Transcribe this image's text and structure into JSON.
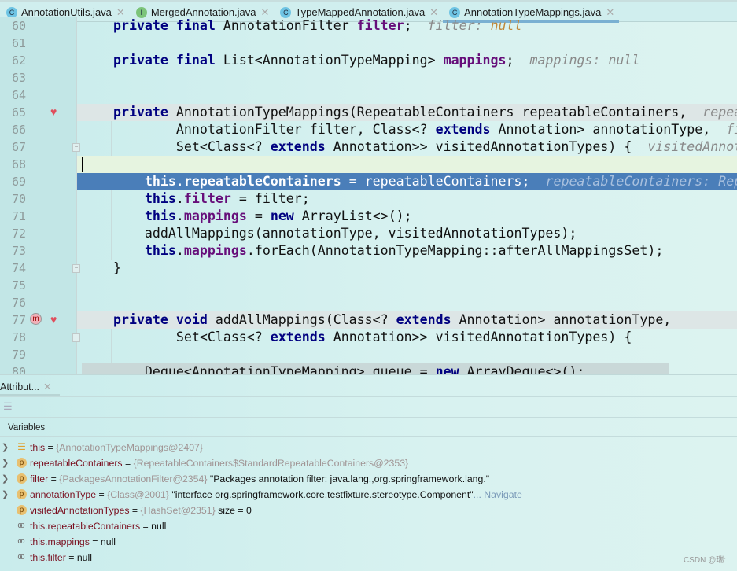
{
  "tabs": [
    {
      "label": "AnnotationUtils.java",
      "icon": "C",
      "kind": "class",
      "active": false
    },
    {
      "label": "MergedAnnotation.java",
      "icon": "I",
      "kind": "interface",
      "active": false
    },
    {
      "label": "TypeMappedAnnotation.java",
      "icon": "C",
      "kind": "class",
      "active": false
    },
    {
      "label": "AnnotationTypeMappings.java",
      "icon": "C",
      "kind": "class",
      "active": true
    }
  ],
  "editor": {
    "lines": [
      {
        "n": "60",
        "t": [
          [
            "    "
          ],
          [
            "private final ",
            "kw"
          ],
          [
            "AnnotationFilter "
          ],
          [
            "filter",
            "fld"
          ],
          [
            ";  "
          ],
          [
            "filter: ",
            "hint"
          ],
          [
            "null",
            "nullv"
          ]
        ]
      },
      {
        "n": "61",
        "t": []
      },
      {
        "n": "62",
        "t": [
          [
            "    "
          ],
          [
            "private final ",
            "kw"
          ],
          [
            "List<AnnotationTypeMapping> "
          ],
          [
            "mappings",
            "fld"
          ],
          [
            ";  "
          ],
          [
            "mappings: null",
            "hint"
          ]
        ]
      },
      {
        "n": "63",
        "t": []
      },
      {
        "n": "64",
        "t": []
      },
      {
        "n": "65",
        "style": "hl",
        "t": [
          [
            "    "
          ],
          [
            "private ",
            "kw"
          ],
          [
            "AnnotationTypeMappings(RepeatableContainers repeatableContainers,  "
          ],
          [
            "repeatableContainers: Re",
            "hint"
          ]
        ]
      },
      {
        "n": "66",
        "t": [
          [
            "            AnnotationFilter filter, Class<? "
          ],
          [
            "extends ",
            "kw"
          ],
          [
            "Annotation> annotationType,  "
          ],
          [
            "filter: ",
            "hint"
          ]
        ]
      },
      {
        "n": "67",
        "t": [
          [
            "            Set<Class<? "
          ],
          [
            "extends ",
            "kw"
          ],
          [
            "Annotation>> visitedAnnotationTypes) {  "
          ],
          [
            "visitedAnnotationTypes",
            "hint"
          ]
        ]
      },
      {
        "n": "68",
        "style": "cur",
        "t": []
      },
      {
        "n": "69",
        "style": "sel",
        "t": [
          [
            "        "
          ],
          [
            "this",
            "kw"
          ],
          [
            "."
          ],
          [
            "repeatableContainers",
            "fld"
          ],
          [
            " = repeatableContainers;  "
          ],
          [
            "repeatableContainers: RepeatableContainers",
            "hint"
          ]
        ]
      },
      {
        "n": "70",
        "t": [
          [
            "        "
          ],
          [
            "this",
            "kw"
          ],
          [
            "."
          ],
          [
            "filter",
            "fld"
          ],
          [
            " = filter;"
          ]
        ]
      },
      {
        "n": "71",
        "t": [
          [
            "        "
          ],
          [
            "this",
            "kw"
          ],
          [
            "."
          ],
          [
            "mappings",
            "fld"
          ],
          [
            " = "
          ],
          [
            "new ",
            "kw"
          ],
          [
            "ArrayList<>();"
          ]
        ]
      },
      {
        "n": "72",
        "t": [
          [
            "        addAllMappings(annotationType, visitedAnnotationTypes);"
          ]
        ]
      },
      {
        "n": "73",
        "t": [
          [
            "        "
          ],
          [
            "this",
            "kw"
          ],
          [
            "."
          ],
          [
            "mappings",
            "fld"
          ],
          [
            ".forEach(AnnotationTypeMapping::afterAllMappingsSet);"
          ]
        ]
      },
      {
        "n": "74",
        "t": [
          [
            "    }"
          ]
        ]
      },
      {
        "n": "75",
        "t": []
      },
      {
        "n": "76",
        "t": []
      },
      {
        "n": "77",
        "style": "hl",
        "t": [
          [
            "    "
          ],
          [
            "private void ",
            "kw"
          ],
          [
            "addAllMappings(Class<? "
          ],
          [
            "extends ",
            "kw"
          ],
          [
            "Annotation> annotationType,"
          ]
        ]
      },
      {
        "n": "78",
        "t": [
          [
            "            Set<Class<? "
          ],
          [
            "extends ",
            "kw"
          ],
          [
            "Annotation>> visitedAnnotationTypes) {"
          ]
        ]
      },
      {
        "n": "79",
        "t": []
      },
      {
        "n": "80",
        "style": "partial",
        "t": [
          [
            "        Deque<AnnotationTypeMapping> queue = "
          ],
          [
            "new ",
            "kw"
          ],
          [
            "ArrayDeque<>();"
          ]
        ]
      }
    ]
  },
  "debug": {
    "tab_label": "Attribut...",
    "variables_label": "Variables",
    "rows": [
      {
        "expand": true,
        "icon": "list",
        "name": "this",
        "ref": "{AnnotationTypeMappings@2407}",
        "value": "",
        "nav": ""
      },
      {
        "expand": true,
        "icon": "p",
        "name": "repeatableContainers",
        "ref": "{RepeatableContainers$StandardRepeatableContainers@2353}",
        "value": "",
        "nav": ""
      },
      {
        "expand": true,
        "icon": "p",
        "name": "filter",
        "ref": "{PackagesAnnotationFilter@2354}",
        "value": "\"Packages annotation filter: java.lang.,org.springframework.lang.\"",
        "nav": ""
      },
      {
        "expand": true,
        "icon": "p",
        "name": "annotationType",
        "ref": "{Class@2001}",
        "value": "\"interface org.springframework.core.testfixture.stereotype.Component\"",
        "nav": "... Navigate"
      },
      {
        "expand": false,
        "icon": "p",
        "name": "visitedAnnotationTypes",
        "ref": "{HashSet@2351}",
        "value": " size = 0",
        "nav": ""
      },
      {
        "expand": false,
        "icon": "watch",
        "name": "this.repeatableContainers",
        "ref": "",
        "value": "null",
        "nav": ""
      },
      {
        "expand": false,
        "icon": "watch",
        "name": "this.mappings",
        "ref": "",
        "value": "null",
        "nav": ""
      },
      {
        "expand": false,
        "icon": "watch",
        "name": "this.filter",
        "ref": "",
        "value": "null",
        "nav": ""
      }
    ]
  },
  "watermark": "CSDN @瑞:"
}
